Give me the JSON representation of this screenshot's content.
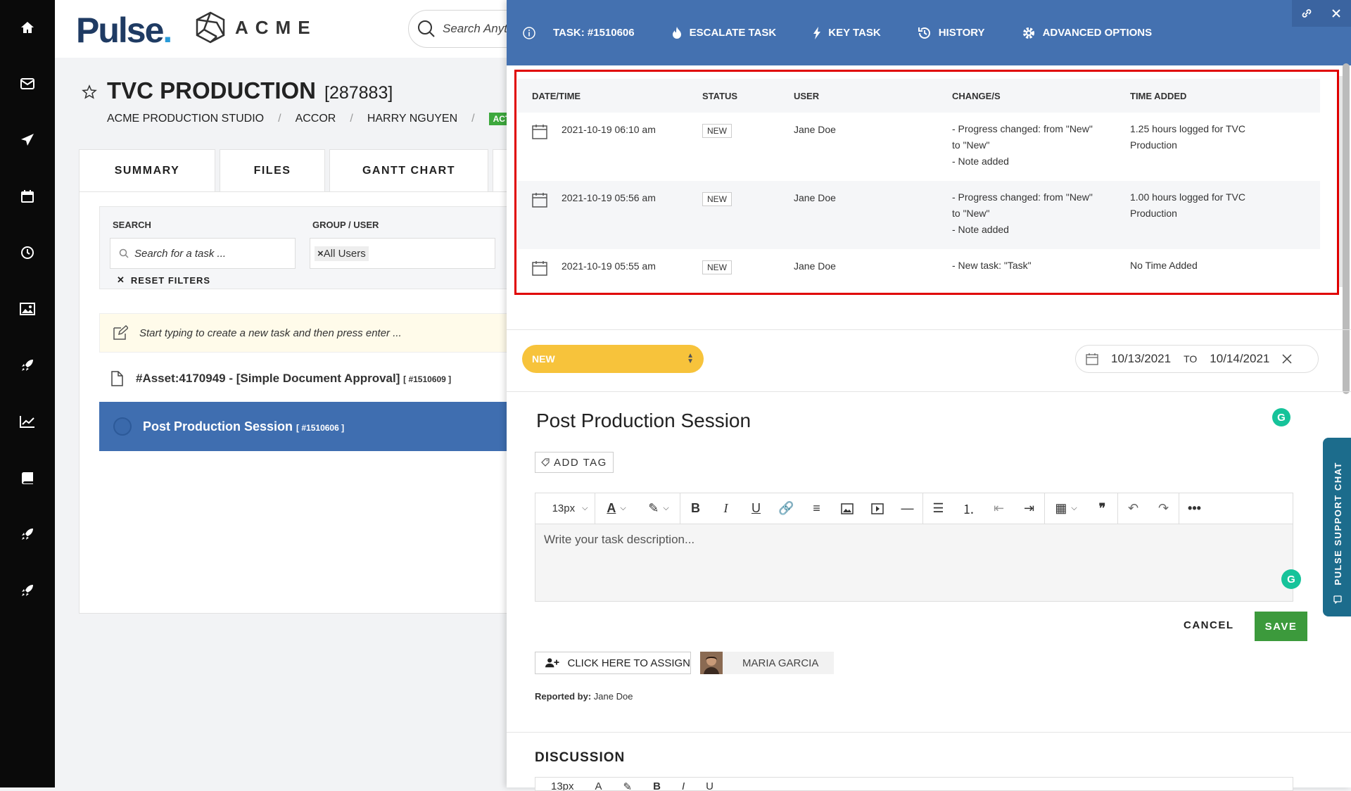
{
  "header": {
    "logo_text": "Pulse",
    "logo_dot": ".",
    "client_logo": "ACME",
    "search_placeholder": "Search Anyth"
  },
  "sidebar": {
    "items": [
      "home-icon",
      "mail-icon",
      "send-icon",
      "calendar-icon",
      "clock-icon",
      "image-icon",
      "rocket-icon",
      "chart-icon",
      "book-icon",
      "rocket-icon",
      "rocket-icon"
    ]
  },
  "project": {
    "title": "TVC PRODUCTION",
    "id": "[287883]",
    "breadcrumbs": [
      "ACME PRODUCTION STUDIO",
      "ACCOR",
      "HARRY NGUYEN"
    ],
    "status_badge": "ACTIV"
  },
  "tabs": [
    "SUMMARY",
    "FILES",
    "GANTT CHART"
  ],
  "filters": {
    "search_label": "SEARCH",
    "search_placeholder": "Search for a task ...",
    "group_label": "GROUP / USER",
    "group_value": "All Users",
    "reset_label": "RESET FILTERS"
  },
  "task_list": {
    "new_task_placeholder": "Start typing to create a new task and then press enter ...",
    "tasks": [
      {
        "title": "#Asset:4170949 - [Simple Document Approval]",
        "id": "[ #1510609 ]"
      },
      {
        "title": "Post Production Session",
        "id": "[ #1510606 ]"
      }
    ]
  },
  "task_panel": {
    "header": {
      "task_label": "TASK: #1510606",
      "escalate": "ESCALATE TASK",
      "key_task": "KEY TASK",
      "history": "HISTORY",
      "advanced": "ADVANCED OPTIONS"
    },
    "history": {
      "columns": [
        "DATE/TIME",
        "STATUS",
        "USER",
        "CHANGE/S",
        "TIME ADDED"
      ],
      "rows": [
        {
          "datetime": "2021-10-19 06:10 am",
          "status": "NEW",
          "user": "Jane Doe",
          "change_1": "- Progress changed: from \"New\"",
          "change_2": "to \"New\"",
          "change_3": "- Note added",
          "time_1": "1.25 hours logged for TVC",
          "time_2": "Production"
        },
        {
          "datetime": "2021-10-19 05:56 am",
          "status": "NEW",
          "user": "Jane Doe",
          "change_1": "- Progress changed: from \"New\"",
          "change_2": "to \"New\"",
          "change_3": "- Note added",
          "time_1": "1.00 hours logged for TVC",
          "time_2": "Production"
        },
        {
          "datetime": "2021-10-19 05:55 am",
          "status": "NEW",
          "user": "Jane Doe",
          "change_1": "- New task: \"Task\"",
          "change_2": "",
          "change_3": "",
          "time_1": "No Time Added",
          "time_2": ""
        }
      ]
    },
    "status_select": "NEW",
    "date_from": "10/13/2021",
    "date_to_label": "TO",
    "date_to": "10/14/2021",
    "title": "Post Production Session",
    "add_tag": "ADD TAG",
    "editor": {
      "font_size": "13px",
      "placeholder": "Write your task description..."
    },
    "cancel": "CANCEL",
    "save": "SAVE",
    "assign_label": "CLICK HERE TO ASSIGN",
    "assignee": "MARIA GARCIA",
    "reported_by_label": "Reported by:",
    "reported_by": "Jane Doe",
    "discussion_label": "DISCUSSION",
    "discussion_font_size": "13px"
  },
  "support_chat": "PULSE SUPPORT CHAT",
  "colors": {
    "header_blue": "#4471b0",
    "selected_row": "#3f6eb0",
    "status_yellow": "#f7c33b",
    "save_green": "#3c9a3c",
    "highlight_red": "#e00000",
    "chat_teal": "#1c6c8c"
  }
}
